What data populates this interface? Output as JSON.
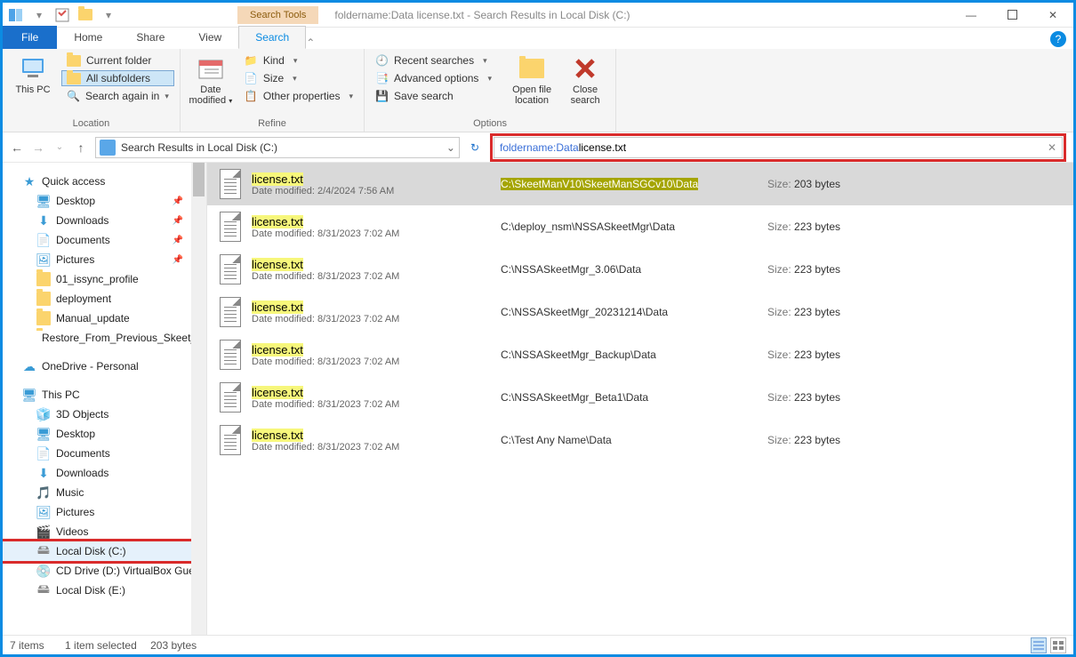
{
  "window": {
    "context_tab": "Search Tools",
    "title": "foldername:Data license.txt - Search Results in Local Disk (C:)"
  },
  "tabs": {
    "file": "File",
    "home": "Home",
    "share": "Share",
    "view": "View",
    "search": "Search"
  },
  "ribbon": {
    "this_pc": "This PC",
    "current_folder": "Current folder",
    "all_subfolders": "All subfolders",
    "search_again": "Search again in",
    "date_modified": "Date modified",
    "kind": "Kind",
    "size": "Size",
    "other_props": "Other properties",
    "recent": "Recent searches",
    "advanced": "Advanced options",
    "save": "Save search",
    "open_loc": "Open file location",
    "close": "Close search",
    "grp_location": "Location",
    "grp_refine": "Refine",
    "grp_options": "Options"
  },
  "nav": {
    "path": "Search Results in Local Disk (C:)",
    "search_prefix": "foldername:Data ",
    "search_term": "license.txt"
  },
  "tree": {
    "quick": "Quick access",
    "desktop": "Desktop",
    "downloads": "Downloads",
    "documents": "Documents",
    "pictures": "Pictures",
    "issync": "01_issync_profile",
    "deployment": "deployment",
    "manual": "Manual_update",
    "restore": "Restore_From_Previous_Skeet_M",
    "onedrive": "OneDrive - Personal",
    "thispc": "This PC",
    "objects3d": "3D Objects",
    "desktop2": "Desktop",
    "documents2": "Documents",
    "downloads2": "Downloads",
    "music": "Music",
    "pictures2": "Pictures",
    "videos": "Videos",
    "localc": "Local Disk (C:)",
    "cddrive": "CD Drive (D:) VirtualBox Guest A",
    "locale": "Local Disk (E:)"
  },
  "labels": {
    "size": "Size:",
    "date_modified": "Date modified:"
  },
  "results": [
    {
      "name": "license.txt",
      "date": "2/4/2024 7:56 AM",
      "path": "C:\\SkeetManV10\\SkeetManSGCv10\\Data",
      "path_hl": true,
      "size": "203 bytes"
    },
    {
      "name": "license.txt",
      "date": "8/31/2023 7:02 AM",
      "path": "C:\\deploy_nsm\\NSSASkeetMgr\\Data",
      "size": "223 bytes"
    },
    {
      "name": "license.txt",
      "date": "8/31/2023 7:02 AM",
      "path": "C:\\NSSASkeetMgr_3.06\\Data",
      "size": "223 bytes"
    },
    {
      "name": "license.txt",
      "date": "8/31/2023 7:02 AM",
      "path": "C:\\NSSASkeetMgr_20231214\\Data",
      "size": "223 bytes"
    },
    {
      "name": "license.txt",
      "date": "8/31/2023 7:02 AM",
      "path": "C:\\NSSASkeetMgr_Backup\\Data",
      "size": "223 bytes"
    },
    {
      "name": "license.txt",
      "date": "8/31/2023 7:02 AM",
      "path": "C:\\NSSASkeetMgr_Beta1\\Data",
      "size": "223 bytes"
    },
    {
      "name": "license.txt",
      "date": "8/31/2023 7:02 AM",
      "path": "C:\\Test Any Name\\Data",
      "size": "223 bytes"
    }
  ],
  "status": {
    "items": "7 items",
    "selected": "1 item selected",
    "size": "203 bytes"
  }
}
